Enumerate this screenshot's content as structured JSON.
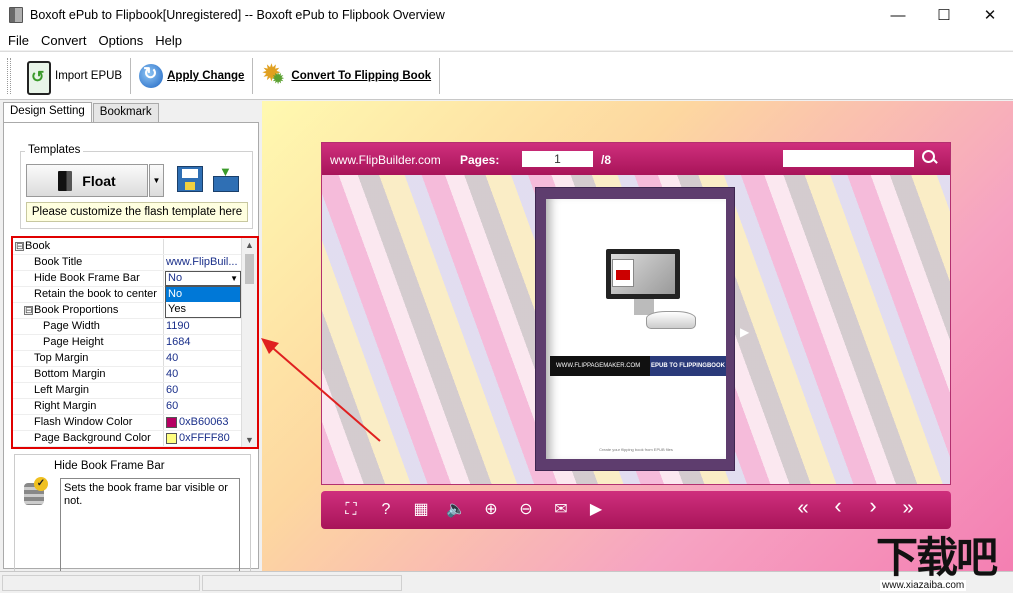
{
  "window": {
    "title": "Boxoft ePub to Flipbook[Unregistered] -- Boxoft ePub to Flipbook Overview",
    "minimize": "—",
    "maximize": "☐",
    "close": "✕"
  },
  "menu": [
    "File",
    "Convert",
    "Options",
    "Help"
  ],
  "toolbar": {
    "import_label": "Import EPUB",
    "apply_label": "Apply Change",
    "convert_label": "Convert To Flipping Book"
  },
  "tabs": [
    "Design Setting",
    "Bookmark"
  ],
  "templates": {
    "legend": "Templates",
    "selected": "Float",
    "note": "Please customize the flash template here"
  },
  "properties": {
    "rows": [
      {
        "name": "Book",
        "value": "",
        "kind": "category",
        "expander": "⊟"
      },
      {
        "name": "Book Title",
        "value": "www.FlipBuil...",
        "kind": "prop"
      },
      {
        "name": "Hide Book Frame Bar",
        "value": "No",
        "kind": "prop"
      },
      {
        "name": "Retain the book to center",
        "value": "",
        "kind": "prop"
      },
      {
        "name": "Book Proportions",
        "value": "",
        "kind": "subcategory",
        "expander": "⊟"
      },
      {
        "name": "Page Width",
        "value": "1190",
        "kind": "sub"
      },
      {
        "name": "Page Height",
        "value": "1684",
        "kind": "sub"
      },
      {
        "name": "Top Margin",
        "value": "40",
        "kind": "prop"
      },
      {
        "name": "Bottom Margin",
        "value": "40",
        "kind": "prop"
      },
      {
        "name": "Left Margin",
        "value": "60",
        "kind": "prop"
      },
      {
        "name": "Right Margin",
        "value": "60",
        "kind": "prop"
      },
      {
        "name": "Flash Window Color",
        "value": "0xB60063",
        "kind": "color",
        "color": "#B60063"
      },
      {
        "name": "Page Background Color",
        "value": "0xFFFF80",
        "kind": "color",
        "color": "#FFFF80"
      }
    ],
    "dropdown": {
      "value": "No",
      "options": [
        "No",
        "Yes"
      ],
      "selected_index": 0
    }
  },
  "description": {
    "title": "Hide Book Frame Bar",
    "text": "Sets the book frame bar visible or not."
  },
  "viewer": {
    "site": "www.FlipBuilder.com",
    "pages_label": "Pages:",
    "current_page": "1",
    "total_pages": "/8",
    "page_band_left": "WWW.FLIPPAGEMAKER.COM",
    "page_band_right": "EPUB TO FLIPPINGBOOK",
    "page_footer": "Create your flipping book from EPUB files",
    "accent_color": "#B60063",
    "controls": [
      "⛶",
      "?",
      "▦",
      "🔈",
      "⊕",
      "⊖",
      "✉",
      "▶",
      "«",
      "‹",
      "›",
      "»"
    ]
  },
  "watermark": {
    "chars": "下载吧",
    "url": "www.xiazaiba.com"
  }
}
